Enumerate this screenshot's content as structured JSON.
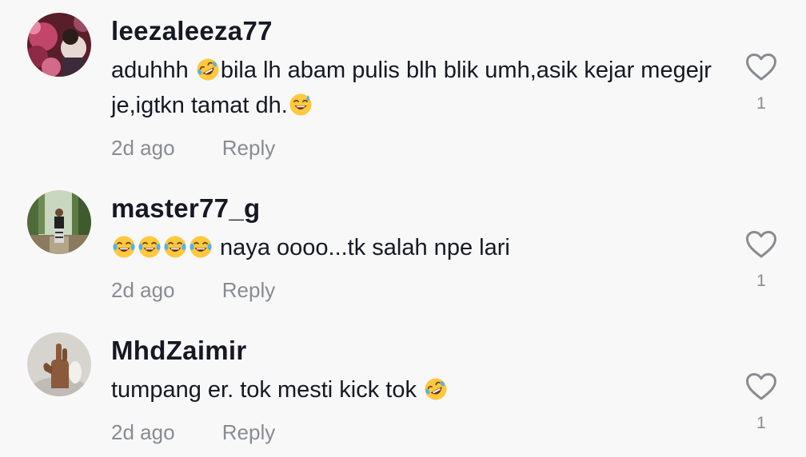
{
  "comments": [
    {
      "username": "leezaleeza77",
      "segments": [
        {
          "t": "text",
          "v": "aduhhh "
        },
        {
          "t": "emoji",
          "v": "rofl"
        },
        {
          "t": "text",
          "v": "bila lh abam pulis blh blik umh,asik kejar megejr je,igtkn tamat dh."
        },
        {
          "t": "emoji",
          "v": "sweat-smile"
        }
      ],
      "time": "2d ago",
      "reply": "Reply",
      "likes": "1",
      "avatar": "flower-photo"
    },
    {
      "username": "master77_g",
      "segments": [
        {
          "t": "emoji",
          "v": "joy"
        },
        {
          "t": "emoji",
          "v": "joy"
        },
        {
          "t": "emoji",
          "v": "joy"
        },
        {
          "t": "emoji",
          "v": "joy"
        },
        {
          "t": "text",
          "v": " naya oooo...tk salah npe lari"
        }
      ],
      "time": "2d ago",
      "reply": "Reply",
      "likes": "1",
      "avatar": "person-in-forest-photo"
    },
    {
      "username": "MhdZaimir",
      "segments": [
        {
          "t": "text",
          "v": "tumpang er. tok mesti kick tok "
        },
        {
          "t": "emoji",
          "v": "rofl"
        }
      ],
      "time": "2d ago",
      "reply": "Reply",
      "likes": "1",
      "avatar": "hand-gesture-photo"
    }
  ],
  "colors": {
    "background": "#f8f8f8",
    "username": "#161823",
    "muted": "#8a8b91",
    "heart_outline": "#8a8b91",
    "emoji_yellow": "#ffc83d"
  },
  "icons": {
    "like": "heart-outline-icon",
    "rofl": "rolling-on-floor-laughing-emoji",
    "joy": "face-with-tears-of-joy-emoji",
    "sweat-smile": "grinning-face-with-sweat-emoji"
  }
}
